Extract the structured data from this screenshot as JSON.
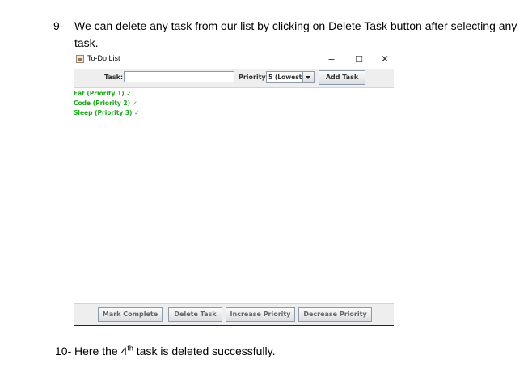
{
  "doc": {
    "step9_number": "9-",
    "step9_line1": "We can delete any task from our list by clicking on Delete Task button after selecting any",
    "step9_line2": "task.",
    "step10_number": "10-",
    "step10_prefix": "Here the 4",
    "step10_sup": "th",
    "step10_suffix": " task is deleted successfully."
  },
  "window": {
    "title": "To-Do List",
    "minimize": "−",
    "maximize": "☐",
    "close": "✕"
  },
  "toolbar": {
    "task_label": "Task:",
    "task_value": "",
    "priority_label": "Priority:",
    "priority_value": "5 (Lowest)",
    "add_label": "Add Task"
  },
  "tasks": [
    "Eat (Priority 1) ✓",
    "Code (Priority 2) ✓",
    "Sleep (Priority 3) ✓"
  ],
  "buttons": {
    "mark_complete": "Mark Complete",
    "delete_task": "Delete Task",
    "increase_priority": "Increase Priority",
    "decrease_priority": "Decrease Priority"
  },
  "colors": {
    "task_text": "#1ea51e",
    "toolbar_bg": "#eeeeee"
  }
}
